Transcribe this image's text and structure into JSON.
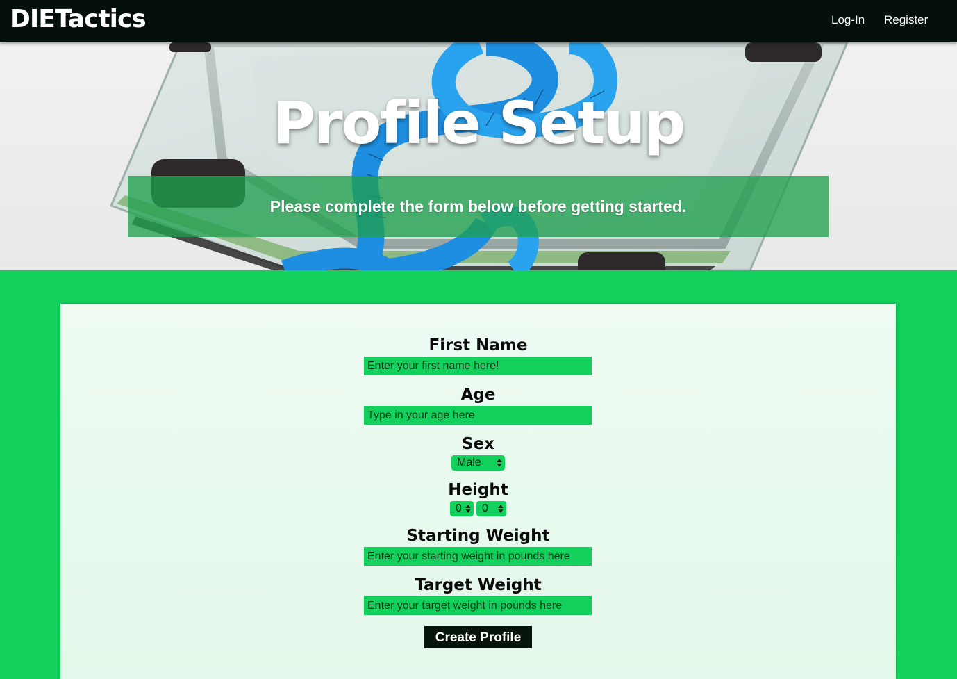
{
  "nav": {
    "brand": "DIETactics",
    "login": "Log-In",
    "register": "Register"
  },
  "hero": {
    "title": "Profile Setup",
    "subtitle": "Please complete the form below before getting started."
  },
  "form": {
    "first_name": {
      "label": "First Name",
      "placeholder": "Enter your first name here!"
    },
    "age": {
      "label": "Age",
      "placeholder": "Type in your age here"
    },
    "sex": {
      "label": "Sex",
      "selected": "Male"
    },
    "height": {
      "label": "Height",
      "feet": "0",
      "inches": "0"
    },
    "starting_weight": {
      "label": "Starting Weight",
      "placeholder": "Enter your starting weight in pounds here"
    },
    "target_weight": {
      "label": "Target Weight",
      "placeholder": "Enter your target weight in pounds here"
    },
    "submit": "Create Profile"
  },
  "colors": {
    "navbar": "#050f0b",
    "accent": "#13d05c",
    "card": "#e6f8ec",
    "button": "#061409"
  }
}
